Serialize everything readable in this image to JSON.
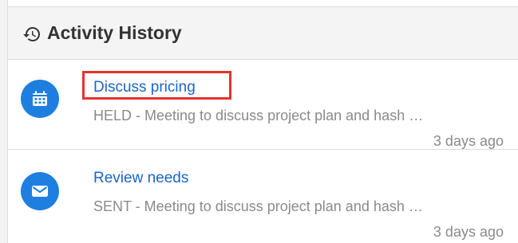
{
  "header": {
    "title": "Activity History",
    "icon": "history-icon"
  },
  "activities": [
    {
      "icon": "calendar-icon",
      "title": "Discuss pricing",
      "description": "HELD - Meeting to discuss project plan and hash …",
      "time": "3 days ago",
      "highlighted": true
    },
    {
      "icon": "mail-icon",
      "title": "Review needs",
      "description": "SENT - Meeting to discuss project plan and hash …",
      "time": "3 days ago",
      "highlighted": false
    }
  ],
  "colors": {
    "accent": "#1e7fe0",
    "link": "#1b65c7",
    "highlight_border": "#e5322d",
    "muted_text": "#8a8a8a"
  }
}
